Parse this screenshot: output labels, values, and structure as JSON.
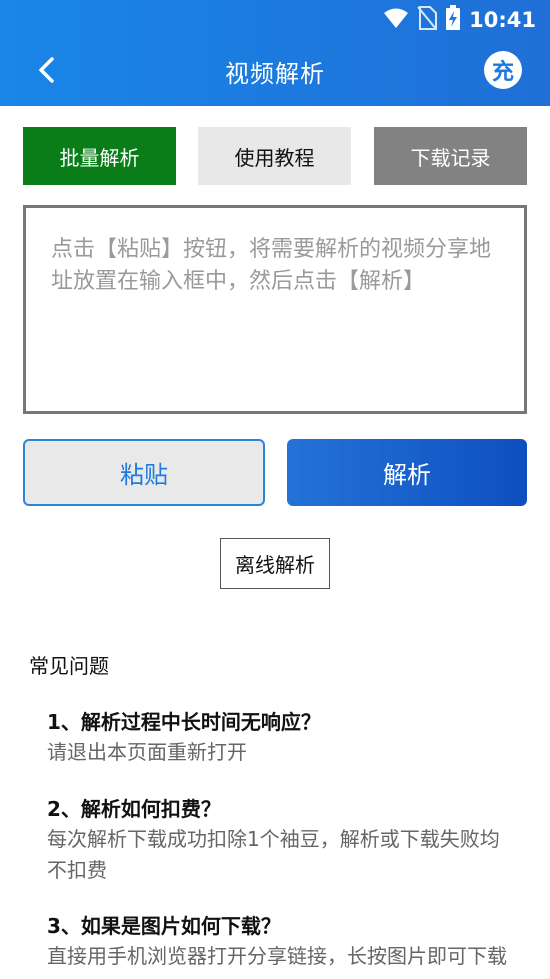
{
  "status_bar": {
    "time": "10:41",
    "icons": [
      "wifi-icon",
      "no-sim-icon",
      "battery-charging-icon"
    ]
  },
  "nav": {
    "title": "视频解析",
    "back_icon": "chevron-left-icon",
    "charge_label": "充"
  },
  "tabs": {
    "batch": "批量解析",
    "tutorial": "使用教程",
    "history": "下载记录"
  },
  "colors": {
    "header": "#1a86e8",
    "batch_tab": "#0a7d19",
    "tutorial_tab": "#e8e8e8",
    "history_tab": "#828282",
    "primary_button": "#1e63cf",
    "paste_border": "#2b83e0"
  },
  "input": {
    "value": "",
    "placeholder": "点击【粘贴】按钮，将需要解析的视频分享地址放置在输入框中，然后点击【解析】"
  },
  "buttons": {
    "paste": "粘贴",
    "parse": "解析",
    "offline": "离线解析"
  },
  "faq": {
    "title": "常见问题",
    "items": [
      {
        "q": "1、解析过程中长时间无响应？",
        "a": "请退出本页面重新打开"
      },
      {
        "q": "2、解析如何扣费？",
        "a": "每次解析下载成功扣除1个袖豆，解析或下载失败均不扣费"
      },
      {
        "q": "3、如果是图片如何下载？",
        "a": "直接用手机浏览器打开分享链接，长按图片即可下载"
      }
    ]
  }
}
